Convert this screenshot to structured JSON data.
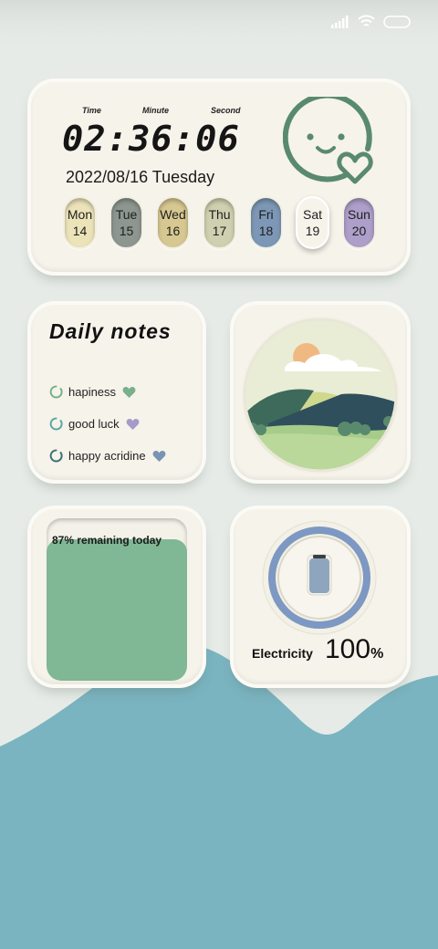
{
  "status_bar": {
    "icons": [
      "signal-icon",
      "wifi-icon",
      "battery-icon"
    ]
  },
  "clock_widget": {
    "labels": {
      "time": "Time",
      "minute": "Minute",
      "second": "Second"
    },
    "display": "02:36:06",
    "date": "2022/08/16 Tuesday",
    "days": [
      {
        "name": "Mon",
        "date": "14",
        "color": "#ece3b9"
      },
      {
        "name": "Tue",
        "date": "15",
        "color": "#8d968f"
      },
      {
        "name": "Wed",
        "date": "16",
        "color": "#d7c892"
      },
      {
        "name": "Thu",
        "date": "17",
        "color": "#cfd0b0"
      },
      {
        "name": "Fri",
        "date": "18",
        "color": "#7d98b6"
      },
      {
        "name": "Sat",
        "date": "19",
        "color": "#f6f3ea"
      },
      {
        "name": "Sun",
        "date": "20",
        "color": "#ad9fc9"
      }
    ],
    "icon": "smiley-heart-icon",
    "accent": "#5a8a6e"
  },
  "notes_widget": {
    "title": "Daily notes",
    "items": [
      {
        "text": "hapiness",
        "spinner_color": "#79b08c",
        "heart_color": "#79b08c"
      },
      {
        "text": "good luck",
        "spinner_color": "#5aa9a3",
        "heart_color": "#a79ac8"
      },
      {
        "text": "happy acridine",
        "spinner_color": "#3e7078",
        "heart_color": "#7894b3"
      }
    ]
  },
  "landscape_widget": {
    "icon": "landscape-illustration"
  },
  "battery_widget": {
    "percent": 87,
    "label": "87%  remaining today",
    "fill_color": "#80b794"
  },
  "electricity_widget": {
    "label": "Electricity",
    "value": "100",
    "unit": "%",
    "ring_color": "#7d98c2",
    "icon": "phone-icon"
  }
}
